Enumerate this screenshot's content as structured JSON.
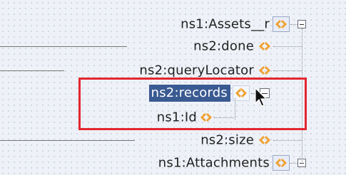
{
  "nodes": [
    {
      "label": "ns1:Assets__r"
    },
    {
      "label": "ns2:done"
    },
    {
      "label": "ns2:queryLocator"
    },
    {
      "label": "ns2:records"
    },
    {
      "label": "ns1:Id"
    },
    {
      "label": "ns2:size"
    },
    {
      "label": "ns1:Attachments"
    }
  ],
  "colors": {
    "selection": "#3a5a92",
    "highlight_border": "#e3262f",
    "icon_orange": "#f0a030"
  },
  "icons": {
    "element": "orange-diamond-arrows-icon",
    "expand": "collapse-box-icon",
    "pointer": "mouse-cursor-icon"
  }
}
